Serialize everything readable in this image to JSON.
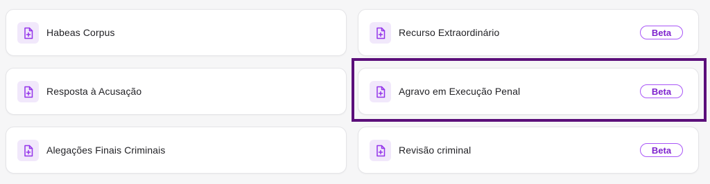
{
  "colors": {
    "accent": "#7e22ce",
    "icon_bg": "#f1e8fb",
    "highlight": "#5b0f7a"
  },
  "cards": [
    {
      "label": "Habeas Corpus",
      "icon": "file-plus-icon"
    },
    {
      "label": "Recurso Extraordinário",
      "icon": "file-plus-icon",
      "badge": "Beta"
    },
    {
      "label": "Resposta à Acusação",
      "icon": "file-plus-icon"
    },
    {
      "label": "Agravo em Execução Penal",
      "icon": "file-plus-icon",
      "badge": "Beta"
    },
    {
      "label": "Alegações Finais Criminais",
      "icon": "file-plus-icon"
    },
    {
      "label": "Revisão criminal",
      "icon": "file-plus-icon",
      "badge": "Beta"
    }
  ]
}
